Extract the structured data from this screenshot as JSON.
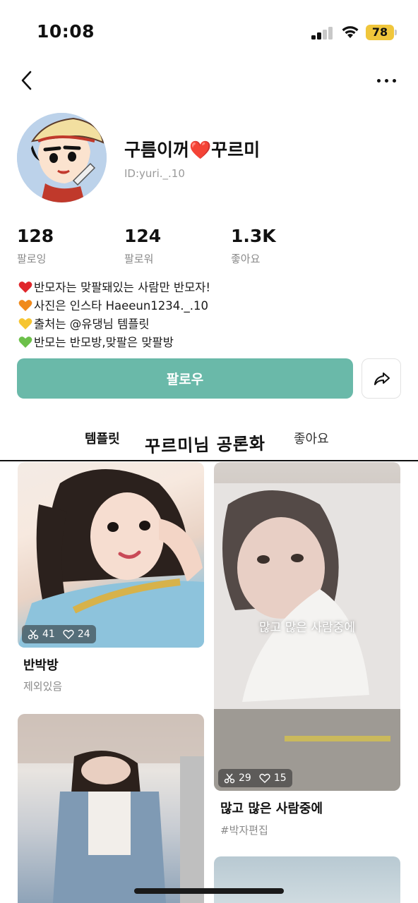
{
  "status_bar": {
    "time": "10:08",
    "battery": "78",
    "battery_color": "#f0c63b"
  },
  "profile": {
    "display_name": "구름이꺼❤️꾸르미",
    "user_id": "ID:yuri._.10",
    "stats": [
      {
        "value": "128",
        "label": "팔로잉"
      },
      {
        "value": "124",
        "label": "팔로워"
      },
      {
        "value": "1.3K",
        "label": "좋아요"
      }
    ],
    "bio": [
      {
        "heart": "red",
        "text": "반모자는 맞팔돼있는 사람만 반모자!"
      },
      {
        "heart": "orange",
        "text": "사진은 인스타 Haeeun1234._.10"
      },
      {
        "heart": "yellow",
        "text": "출처는 @유댕님 템플릿"
      },
      {
        "heart": "green",
        "text": "반모는 반모방,맞팔은 맞팔방"
      }
    ],
    "follow_label": "팔로우",
    "accent_color": "#6ab9a9"
  },
  "tabs": {
    "templates": "템플릿",
    "likes": "좋아요"
  },
  "overlay_handwriting": "꾸르미님 공론화",
  "cards": [
    {
      "title": "반박방",
      "subtitle": "제외있음",
      "uses": "41",
      "likes": "24"
    },
    {
      "title": "많고 많은 사람중에",
      "subtitle": "#박자편집",
      "uses": "29",
      "likes": "15",
      "caption": "많고 많은 사람중에"
    }
  ],
  "icons": {
    "back": "chevron-left-icon",
    "more": "more-dots-icon",
    "share": "share-arrow-icon",
    "scissors": "scissors-icon",
    "like": "heart-outline-icon"
  }
}
